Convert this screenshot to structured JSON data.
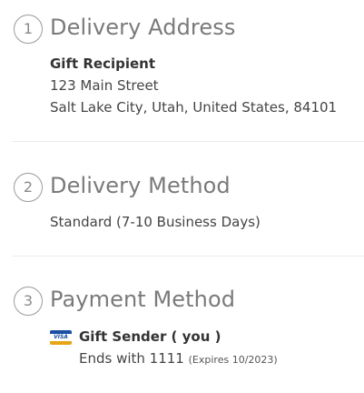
{
  "delivery_address": {
    "step_number": "1",
    "title": "Delivery Address",
    "recipient_name": "Gift Recipient",
    "street": "123 Main Street",
    "city_line": "Salt Lake City, Utah, United States, 84101"
  },
  "delivery_method": {
    "step_number": "2",
    "title": "Delivery Method",
    "method": "Standard (7-10 Business Days)"
  },
  "payment_method": {
    "step_number": "3",
    "title": "Payment Method",
    "card_icon": "visa-card-icon",
    "card_brand_text": "VISA",
    "payer": "Gift Sender ( you )",
    "ends_with": "Ends with 1111",
    "expires": "(Expires 10/2023)"
  },
  "colors": {
    "text": "#444444",
    "title": "#7a7a7a",
    "divider": "#ececec",
    "visa_blue": "#1a4fa3",
    "visa_gold": "#e6a417"
  }
}
